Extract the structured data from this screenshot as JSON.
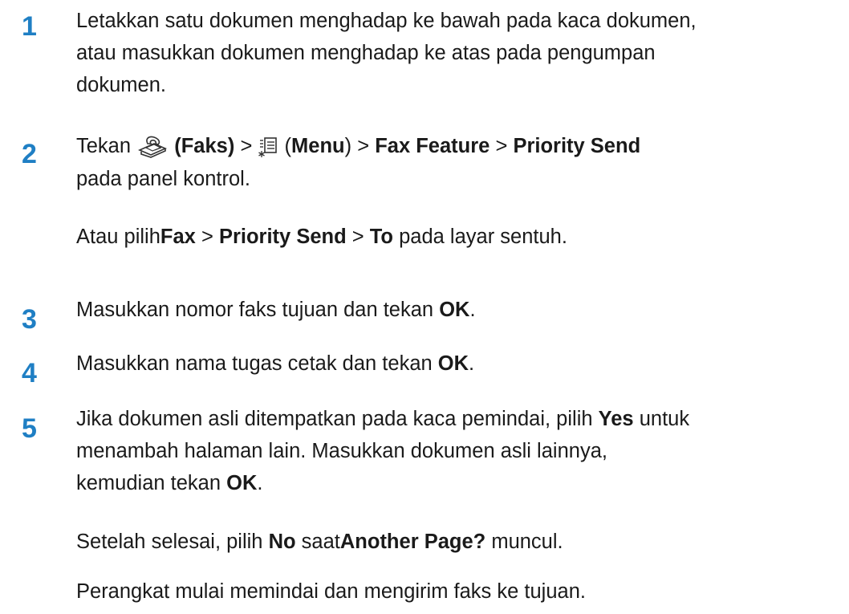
{
  "steps": [
    {
      "number": "1",
      "lines": [
        "Letakkan satu dokumen menghadap ke bawah pada kaca dokumen,",
        "atau masukkan dokumen menghadap ke atas pada pengumpan",
        "dokumen."
      ]
    },
    {
      "number": "2",
      "t_tekan": "Tekan",
      "faks": "(Faks)",
      "gt": ">",
      "paren_open": "(",
      "menu": "Menu",
      "paren_close": ")",
      "fax_feature": "Fax Feature",
      "priority_send": "Priority Send",
      "line2": "pada panel kontrol.",
      "alt_prefix": "Atau pilih",
      "alt_fax": "Fax",
      "alt_priority": "Priority Send",
      "alt_to": "To",
      "alt_suffix": "pada layar sentuh.",
      "icons": [
        "fax-icon",
        "menu-icon"
      ]
    },
    {
      "number": "3",
      "text": "Masukkan nomor faks tujuan dan tekan",
      "ok": "OK",
      "end": "."
    },
    {
      "number": "4",
      "text": "Masukkan nama tugas cetak dan tekan",
      "ok": "OK",
      "end": "."
    },
    {
      "number": "5",
      "line1_pre": "Jika dokumen asli ditempatkan pada kaca pemindai, pilih",
      "yes": "Yes",
      "line1_post": "untuk",
      "line2": "menambah halaman lain. Masukkan dokumen asli lainnya,",
      "line3_pre": "kemudian tekan",
      "ok": "OK",
      "end": ".",
      "p2_pre": "Setelah selesai, pilih",
      "no": "No",
      "p2_mid": "saat",
      "another_page": "Another Page?",
      "p2_post": "muncul.",
      "p3": "Perangkat mulai memindai dan mengirim faks ke tujuan."
    }
  ]
}
